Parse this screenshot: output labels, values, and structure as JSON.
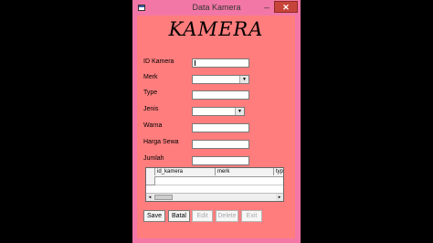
{
  "window": {
    "title": "Data Kamera",
    "minimize_glyph": "_",
    "close_glyph": "✕",
    "app_icon": "form-icon"
  },
  "heading": "KAMERA",
  "form": {
    "fields": [
      {
        "label": "ID Kamera",
        "kind": "text",
        "value": ""
      },
      {
        "label": "Merk",
        "kind": "combo",
        "value": ""
      },
      {
        "label": "Type",
        "kind": "text",
        "value": ""
      },
      {
        "label": "Jenis",
        "kind": "combo",
        "value": ""
      },
      {
        "label": "Warna",
        "kind": "text",
        "value": ""
      },
      {
        "label": "Harga Sewa",
        "kind": "text",
        "value": ""
      },
      {
        "label": "Jumlah",
        "kind": "text",
        "value": ""
      }
    ]
  },
  "grid": {
    "columns": [
      "id_kamera",
      "merk",
      "typ"
    ],
    "scroll_left": "◂",
    "scroll_right": "▸"
  },
  "buttons": {
    "save": {
      "label": "Save",
      "enabled": true
    },
    "cancel": {
      "label": "Batal",
      "enabled": true
    },
    "edit": {
      "label": "Edit",
      "enabled": false
    },
    "delete": {
      "label": "Delete",
      "enabled": false
    },
    "exit": {
      "label": "Exit",
      "enabled": false
    }
  },
  "colors": {
    "window_frame": "#f277a6",
    "client_bg": "#ff7d7d",
    "close_button": "#c7443a",
    "outside": "#000000"
  }
}
